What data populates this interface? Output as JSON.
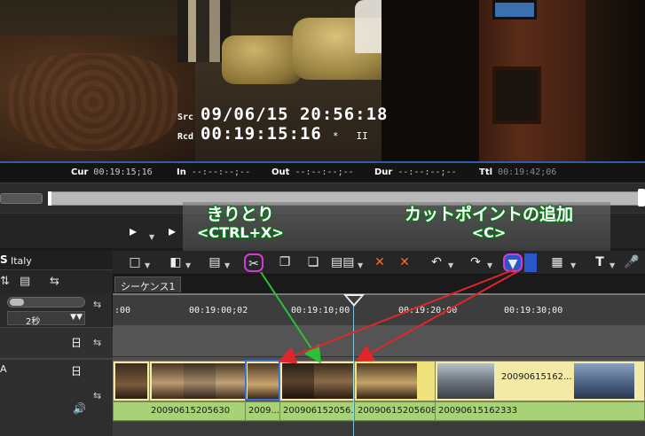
{
  "preview": {
    "src_label": "Src",
    "src_timecode": "09/06/15  20:56:18",
    "rcd_label": "Rcd",
    "rcd_timecode": "00:19:15:16",
    "rcd_marker": "*",
    "pause_glyph": "II"
  },
  "status": {
    "cur_label": "Cur",
    "cur_value": "00:19:15;16",
    "in_label": "In",
    "in_value": "--:--:--;--",
    "out_label": "Out",
    "out_value": "--:--:--;--",
    "dur_label": "Dur",
    "dur_value": "--:--:--;--",
    "ttl_label": "Ttl",
    "ttl_value": "00:19:42;06"
  },
  "callouts": {
    "cut_title": "きりとり",
    "cut_shortcut": "<CTRL+X>",
    "cutpoint_title": "カットポイントの追加",
    "cutpoint_shortcut": "<C>"
  },
  "left_panel": {
    "project_prefix": "S",
    "project_name": "Italy",
    "scale_value": "2秒",
    "track_label": "A"
  },
  "sequence": {
    "tab_label": "シーケンス1"
  },
  "ruler": {
    "labels": [
      ":00",
      "00:19:00;02",
      "00:19:10;00",
      "00:19:20;00",
      "00:19:30;00"
    ]
  },
  "clips": {
    "clip5_label": "200906151​62...",
    "audio": [
      "20090615205630",
      "2009...",
      "200906152056...",
      "20090615205608",
      "20090615162333"
    ]
  },
  "colors": {
    "accent_blue": "#2a56c8",
    "highlight_magenta": "#d13bd6",
    "arrow_red": "#e0262b",
    "arrow_green": "#2cbf3a",
    "clip_video": "#f2eaa6",
    "clip_audio": "#a8d278"
  }
}
